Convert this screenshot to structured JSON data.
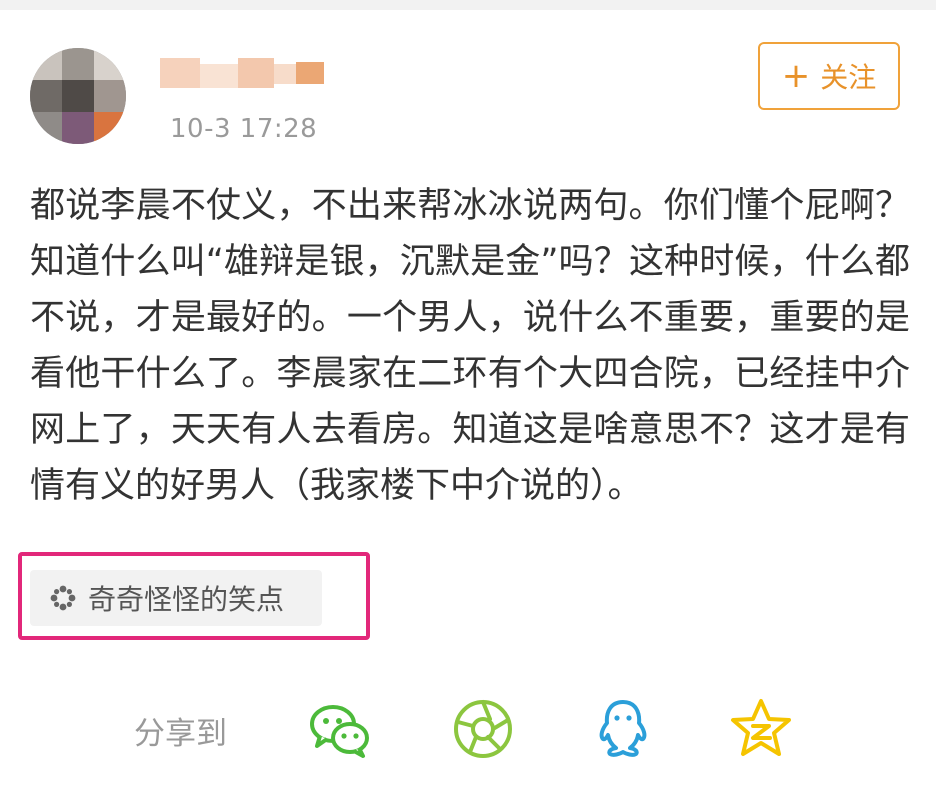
{
  "post": {
    "timestamp": "10-3 17:28",
    "follow_label": "关注",
    "body": "都说李晨不仗义，不出来帮冰冰说两句。你们懂个屁啊？知道什么叫“雄辩是银，沉默是金”吗？这种时候，什么都不说，才是最好的。一个男人，说什么不重要，重要的是看他干什么了。李晨家在二环有个大四合院，已经挂中介网上了，天天有人去看房。知道这是啥意思不？这才是有情有义的好男人（我家楼下中介说的）。",
    "topic_tag": "奇奇怪怪的笑点"
  },
  "share": {
    "label": "分享到",
    "targets": [
      "wechat-icon",
      "moments-icon",
      "qq-icon",
      "qzone-icon"
    ]
  },
  "colors": {
    "follow_accent": "#f0a23a",
    "highlight_border": "#e2277a",
    "wechat": "#4cba3a",
    "moments": "#8cc63f",
    "qq": "#2b9fd9",
    "qzone": "#f5c400"
  }
}
